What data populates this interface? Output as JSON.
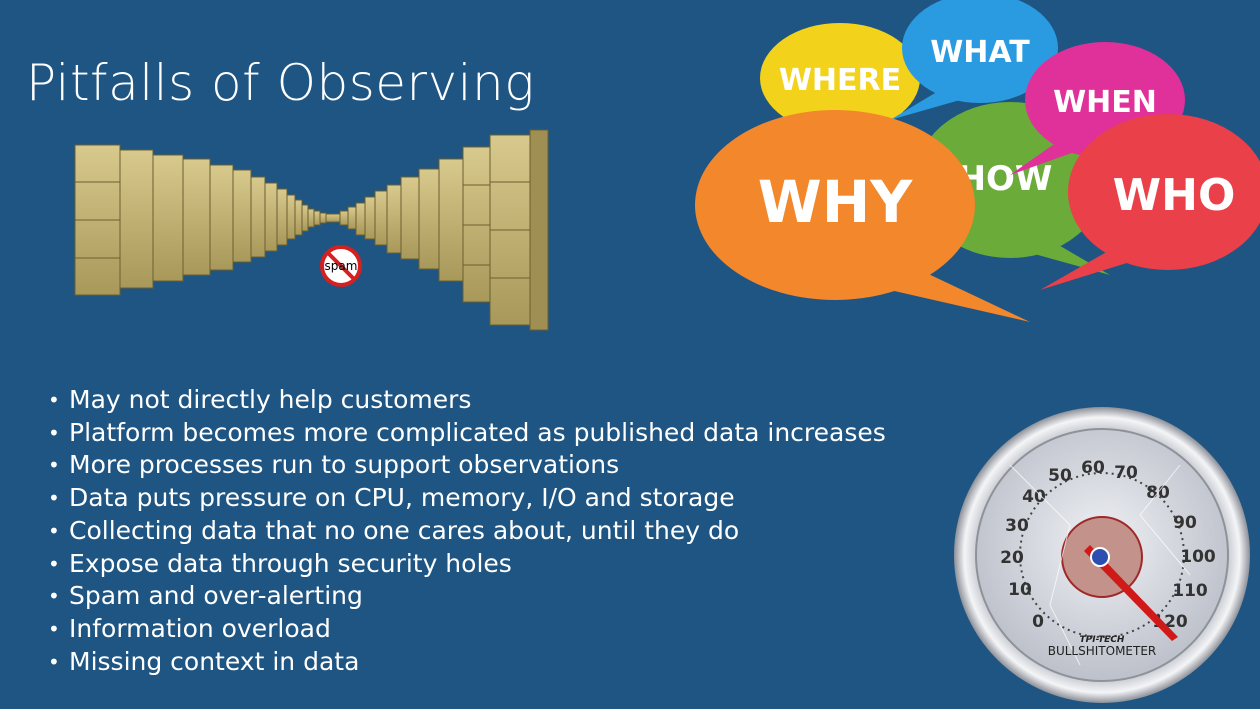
{
  "slide": {
    "title": "Pitfalls of Observing",
    "bullets": [
      "May not directly help customers",
      "Platform becomes more complicated as published data increases",
      "More processes run to support observations",
      "Data puts pressure on CPU, memory, I/O and storage",
      "Collecting data that no one cares about, until they do",
      "Expose data through security holes",
      "Spam and over-alerting",
      "Information overload",
      "Missing context in data"
    ]
  },
  "cabinets_image": {
    "icon": "file-cabinets-corridor",
    "spam_sign_label": "spam",
    "spam_sign_icon": "no-spam-icon"
  },
  "bubbles_image": {
    "icon": "speech-bubbles",
    "labels": {
      "where": "WHERE",
      "what": "WHAT",
      "when": "WHEN",
      "how": "HOW",
      "why": "WHY",
      "who": "WHO"
    },
    "colors": {
      "where": "#f3d21c",
      "what": "#2a9be0",
      "when": "#e0309a",
      "how": "#6aab3a",
      "why": "#f2872c",
      "who": "#e9404a"
    }
  },
  "gauge_image": {
    "icon": "bullshitometer-gauge",
    "scale": [
      "0",
      "10",
      "20",
      "30",
      "40",
      "50",
      "60",
      "70",
      "80",
      "90",
      "100",
      "110",
      "120"
    ],
    "brand": "TPI-TECH",
    "label": "BULLSHITOMETER"
  },
  "colors": {
    "background": "#1e5583",
    "text": "#ffffff"
  }
}
